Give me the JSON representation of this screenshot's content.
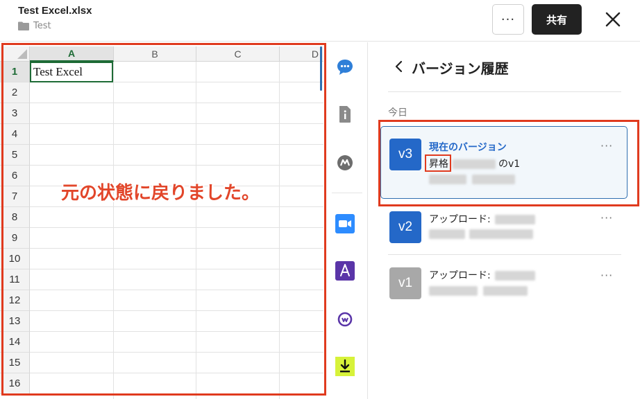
{
  "header": {
    "file_title": "Test Excel.xlsx",
    "folder_name": "Test",
    "more_label": "···",
    "share_label": "共有"
  },
  "sheet": {
    "columns": [
      "A",
      "B",
      "C",
      "D"
    ],
    "rows": [
      "1",
      "2",
      "3",
      "4",
      "5",
      "6",
      "7",
      "8",
      "9",
      "10",
      "11",
      "12",
      "13",
      "14",
      "15",
      "16"
    ],
    "cell_a1": "Test Excel",
    "annotation": "元の状態に戻りました。"
  },
  "panel": {
    "title": "バージョン履歴",
    "today_label": "今日",
    "versions": [
      {
        "badge": "v3",
        "title": "現在のバージョン",
        "action": "昇格",
        "suffix": "のv1",
        "more": "···",
        "badge_color": "#2468c8"
      },
      {
        "badge": "v2",
        "title": "アップロード:",
        "more": "···",
        "badge_color": "#2468c8"
      },
      {
        "badge": "v1",
        "title": "アップロード:",
        "more": "···",
        "badge_color": "#a8a8a8"
      }
    ]
  },
  "colors": {
    "accent": "#2468c8",
    "annotation": "#e03a1e",
    "selection": "#1e6b36"
  },
  "icons": [
    "folder-icon",
    "close-icon",
    "comment-icon",
    "info-icon",
    "m-app-icon",
    "zoom-icon",
    "acrobat-icon",
    "webex-icon",
    "download-icon",
    "chevron-left-icon"
  ]
}
